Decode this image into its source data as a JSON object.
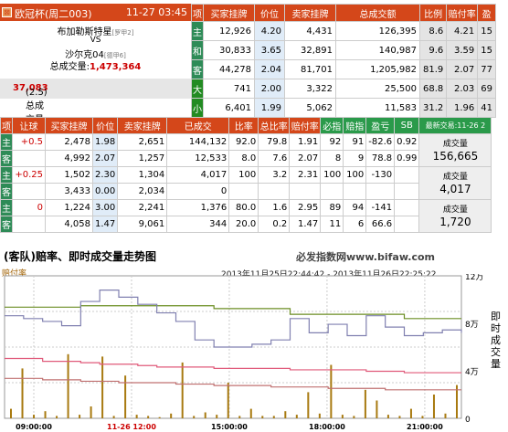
{
  "match": {
    "league": "欧冠杯",
    "weekday_code": "(周二003)",
    "datetime": "11-27 03:45",
    "home": "布加勒斯特星",
    "home_rank": "[罗甲2]",
    "vs": "VS",
    "away": "沙尔克04",
    "away_rank": "[德甲6]",
    "total_label": "总成交量:",
    "total_value": "1,473,364",
    "handicap_label": "(2.5)总成交量:",
    "handicap_value": "37,083"
  },
  "top_table": {
    "headers": [
      "项",
      "买家挂牌",
      "价位",
      "卖家挂牌",
      "总成交额",
      "比例",
      "赔付率",
      "盈"
    ],
    "rows": [
      {
        "label": "主",
        "buy": "12,926",
        "price": "4.20",
        "sell": "4,431",
        "total": "126,395",
        "ratio": "8.6",
        "rate": "4.21",
        "pl": "15"
      },
      {
        "label": "和",
        "buy": "30,833",
        "price": "3.65",
        "sell": "32,891",
        "total": "140,987",
        "ratio": "9.6",
        "rate": "3.59",
        "pl": "15"
      },
      {
        "label": "客",
        "buy": "44,278",
        "price": "2.04",
        "sell": "81,701",
        "total": "1,205,982",
        "ratio": "81.9",
        "rate": "2.07",
        "pl": "77"
      },
      {
        "label": "大",
        "buy": "741",
        "price": "2.00",
        "sell": "3,322",
        "total": "25,500",
        "ratio": "68.8",
        "rate": "2.03",
        "pl": "69"
      },
      {
        "label": "小",
        "buy": "6,401",
        "price": "1.99",
        "sell": "5,062",
        "total": "11,583",
        "ratio": "31.2",
        "rate": "1.96",
        "pl": "41"
      }
    ]
  },
  "mid_table": {
    "headers": [
      "项",
      "让球",
      "买家挂牌",
      "价位",
      "卖家挂牌",
      "已成交",
      "比率",
      "总比率",
      "赔付率",
      "必指",
      "赔指",
      "盈亏",
      "SB"
    ],
    "latest": "最新交易:11-26 2",
    "rows": [
      {
        "label": "主",
        "hcap": "+0.5",
        "buy": "2,478",
        "price": "1.98",
        "sell": "2,651",
        "done": "144,132",
        "r": "92.0",
        "tr": "79.8",
        "pay": "1.91",
        "bi": "92",
        "pi": "91",
        "pl": "-82.6",
        "sb": "0.92"
      },
      {
        "label": "客",
        "hcap": "",
        "buy": "4,992",
        "price": "2.07",
        "sell": "1,257",
        "done": "12,533",
        "r": "8.0",
        "tr": "7.6",
        "pay": "2.07",
        "bi": "8",
        "pi": "9",
        "pl": "78.8",
        "sb": "0.99"
      },
      {
        "label": "主",
        "hcap": "+0.25",
        "buy": "1,502",
        "price": "2.30",
        "sell": "1,304",
        "done": "4,017",
        "r": "100",
        "tr": "3.2",
        "pay": "2.31",
        "bi": "100",
        "pi": "100",
        "pl": "-130",
        "sb": ""
      },
      {
        "label": "客",
        "hcap": "",
        "buy": "3,433",
        "price": "0.00",
        "sell": "2,034",
        "done": "0",
        "r": "",
        "tr": "",
        "pay": "",
        "bi": "",
        "pi": "",
        "pl": "",
        "sb": ""
      },
      {
        "label": "主",
        "hcap": "0",
        "buy": "1,224",
        "price": "3.00",
        "sell": "2,241",
        "done": "1,376",
        "r": "80.0",
        "tr": "1.6",
        "pay": "2.95",
        "bi": "89",
        "pi": "94",
        "pl": "-141",
        "sb": ""
      },
      {
        "label": "客",
        "hcap": "",
        "buy": "4,058",
        "price": "1.47",
        "sell": "9,061",
        "done": "344",
        "r": "20.0",
        "tr": "0.2",
        "pay": "1.47",
        "bi": "11",
        "pi": "6",
        "pl": "66.6",
        "sb": ""
      }
    ],
    "summaries": [
      {
        "label": "成交量",
        "value": "156,665"
      },
      {
        "label": "成交量",
        "value": "4,017"
      },
      {
        "label": "成交量",
        "value": "1,720"
      }
    ]
  },
  "chart_header": {
    "title": "(客队)赔率、即时成交量走势图",
    "site": "必发指数网www.bifaw.com",
    "left_label": "赔付率",
    "range": "2013年11月25日22:44:42 - 2013年11月26日22:25:22",
    "right_label": "即时成交量"
  },
  "chart_data": {
    "type": "line",
    "x_ticks": [
      "09:00:00",
      "11-26 12:00",
      "15:00:00",
      "18:00:00",
      "21:00:00"
    ],
    "x_tick_colors": [
      "#000000",
      "#cc0000",
      "#000000",
      "#000000",
      "#000000"
    ],
    "y_right_ticks": [
      "12万",
      "8万",
      "4万",
      "0"
    ],
    "y_right_range": [
      0,
      120000
    ],
    "series": [
      {
        "color": "#6b8e23",
        "values": [
          0.78,
          0.78,
          0.78,
          0.78,
          0.79,
          0.79,
          0.79,
          0.79,
          0.79,
          0.79,
          0.79,
          0.77,
          0.77,
          0.77,
          0.77,
          0.73,
          0.73,
          0.73,
          0.73,
          0.73,
          0.73,
          0.7,
          0.7,
          0.7,
          0.7
        ]
      },
      {
        "color": "#8080b0",
        "values": [
          0.72,
          0.7,
          0.68,
          0.65,
          0.82,
          0.9,
          0.85,
          0.8,
          0.74,
          0.68,
          0.55,
          0.5,
          0.5,
          0.52,
          0.55,
          0.7,
          0.6,
          0.66,
          0.58,
          0.72,
          0.64,
          0.58,
          0.6,
          0.62,
          0.6
        ]
      },
      {
        "color": "#e05a7a",
        "values": [
          0.42,
          0.42,
          0.4,
          0.4,
          0.39,
          0.38,
          0.38,
          0.37,
          0.36,
          0.36,
          0.36,
          0.35,
          0.35,
          0.35,
          0.35,
          0.34,
          0.34,
          0.34,
          0.34,
          0.33,
          0.33,
          0.32,
          0.32,
          0.32,
          0.32
        ]
      },
      {
        "color": "#c07070",
        "values": [
          0.28,
          0.28,
          0.27,
          0.27,
          0.26,
          0.26,
          0.25,
          0.25,
          0.25,
          0.24,
          0.24,
          0.23,
          0.23,
          0.23,
          0.22,
          0.22,
          0.22,
          0.21,
          0.21,
          0.21,
          0.2,
          0.2,
          0.2,
          0.2,
          0.2
        ]
      }
    ],
    "volume": [
      8000,
      42000,
      3000,
      6000,
      2000,
      54000,
      3000,
      10000,
      52000,
      2000,
      36000,
      3000,
      2000,
      1000,
      4000,
      47000,
      2000,
      5000,
      3000,
      30000,
      2000,
      8000,
      2000,
      2000,
      6000,
      3000,
      22000,
      4000,
      45000,
      3000,
      2000,
      24000,
      15000,
      3000,
      2000,
      8000,
      2000,
      20000,
      4000,
      28000
    ]
  }
}
